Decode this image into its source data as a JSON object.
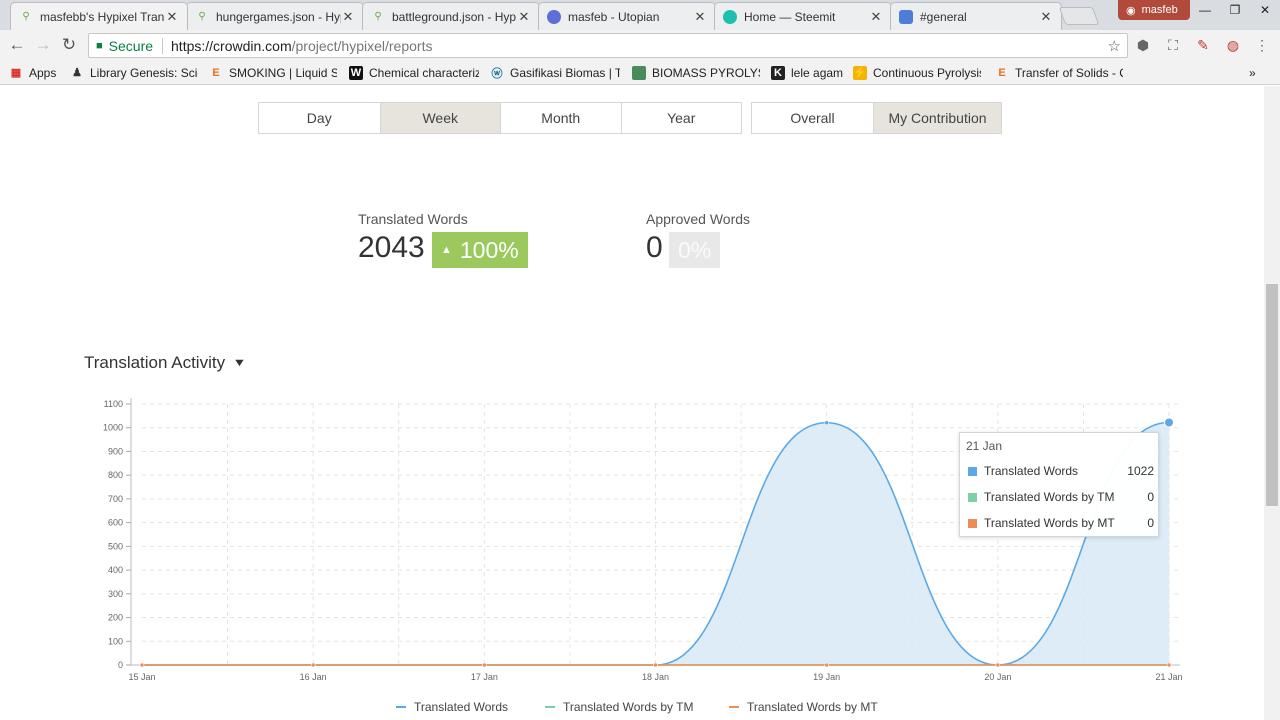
{
  "browser": {
    "tabs": [
      {
        "title": "masfebb's Hypixel Trans",
        "active": true,
        "icon": "crowdin-icon"
      },
      {
        "title": "hungergames.json - Hyp",
        "active": false,
        "icon": "crowdin-icon"
      },
      {
        "title": "battleground.json - Hyp",
        "active": false,
        "icon": "crowdin-icon"
      },
      {
        "title": "masfeb - Utopian",
        "active": false,
        "icon": "utopian-icon"
      },
      {
        "title": "Home — Steemit",
        "active": false,
        "icon": "steemit-icon"
      },
      {
        "title": "#general",
        "active": false,
        "icon": "discord-icon"
      }
    ],
    "profile_name": "masfeb",
    "secure_label": "Secure",
    "url_host": "https://crowdin.com",
    "url_path": "/project/hypixel/reports",
    "bookmarks": [
      {
        "label": "Apps"
      },
      {
        "label": "Library Genesis: Scien"
      },
      {
        "label": "SMOKING | Liquid Sm"
      },
      {
        "label": "Chemical characteriza"
      },
      {
        "label": "Gasifikasi Biomas | Te"
      },
      {
        "label": "BIOMASS PYROLYSIS"
      },
      {
        "label": "lele agam"
      },
      {
        "label": "Continuous Pyrolysis"
      },
      {
        "label": "Transfer of Solids - C"
      }
    ],
    "more_bookmarks": "»"
  },
  "period_buttons": [
    {
      "label": "Day",
      "selected": false
    },
    {
      "label": "Week",
      "selected": true
    },
    {
      "label": "Month",
      "selected": false
    },
    {
      "label": "Year",
      "selected": false
    }
  ],
  "scope_buttons": [
    {
      "label": "Overall",
      "selected": false
    },
    {
      "label": "My Contribution",
      "selected": true
    }
  ],
  "stats": {
    "translated": {
      "label": "Translated Words",
      "value": "2043",
      "change": "100%"
    },
    "approved": {
      "label": "Approved Words",
      "value": "0",
      "change": "0%"
    }
  },
  "section_title": "Translation Activity",
  "colors": {
    "translated": "#5aa9e6",
    "tm": "#7fcfa6",
    "mt": "#ee8c55",
    "badge_green": "#9cc95e"
  },
  "chart_data": {
    "type": "area",
    "x": [
      "15 Jan",
      "16 Jan",
      "17 Jan",
      "18 Jan",
      "19 Jan",
      "20 Jan",
      "21 Jan"
    ],
    "series": [
      {
        "name": "Translated Words",
        "values": [
          0,
          0,
          0,
          0,
          1021,
          0,
          1022
        ]
      },
      {
        "name": "Translated Words by TM",
        "values": [
          0,
          0,
          0,
          0,
          0,
          0,
          0
        ]
      },
      {
        "name": "Translated Words by MT",
        "values": [
          0,
          0,
          0,
          0,
          0,
          0,
          0
        ]
      }
    ],
    "ylim": [
      0,
      1100
    ],
    "yticks": [
      0,
      100,
      200,
      300,
      400,
      500,
      600,
      700,
      800,
      900,
      1000,
      1100
    ],
    "grid": true,
    "legend_position": "bottom",
    "tooltip": {
      "date": "21 Jan",
      "rows": [
        {
          "name": "Translated Words",
          "value": "1022"
        },
        {
          "name": "Translated Words by TM",
          "value": "0"
        },
        {
          "name": "Translated Words by MT",
          "value": "0"
        }
      ]
    }
  }
}
